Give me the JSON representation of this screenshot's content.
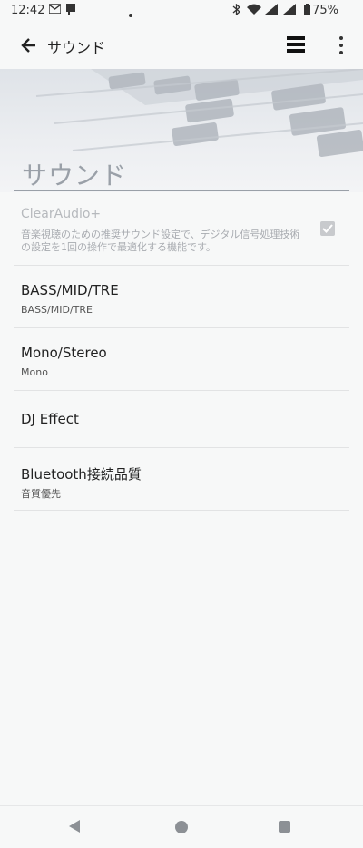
{
  "status": {
    "time": "12:42",
    "battery_pct": "75%"
  },
  "app_bar": {
    "title": "サウンド"
  },
  "hero": {
    "title": "サウンド"
  },
  "items": {
    "clear_audio": {
      "title": "ClearAudio+",
      "desc": "音楽視聴のための推奨サウンド設定で、デジタル信号処理技術の設定を1回の操作で最適化する機能です。",
      "checked": true
    },
    "bass": {
      "title": "BASS/MID/TRE",
      "sub": "BASS/MID/TRE"
    },
    "mono": {
      "title": "Mono/Stereo",
      "sub": "Mono"
    },
    "dj": {
      "title": "DJ Effect"
    },
    "bluetooth": {
      "title": "Bluetooth接続品質",
      "sub": "音質優先"
    }
  },
  "colors": {
    "background": "#f7f8f8",
    "divider": "#e2e3e4",
    "disabled_text": "#b6b9bd"
  }
}
